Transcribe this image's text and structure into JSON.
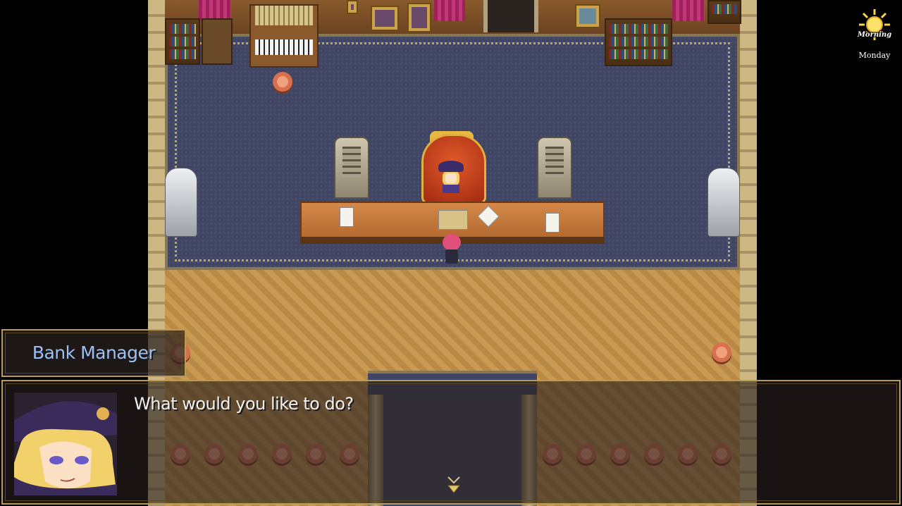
{
  "hud": {
    "time_of_day": "Morning",
    "day": "Monday",
    "time_icon": "sun-icon"
  },
  "dialog": {
    "speaker": "Bank Manager",
    "message": "What would you like to do?",
    "portrait": "witch-portrait",
    "continue_icon": "continue-arrow-icon"
  },
  "colors": {
    "name_text": "#9ec0ee",
    "message_text": "#f4f0e8",
    "window_border": "#b89a5a"
  }
}
